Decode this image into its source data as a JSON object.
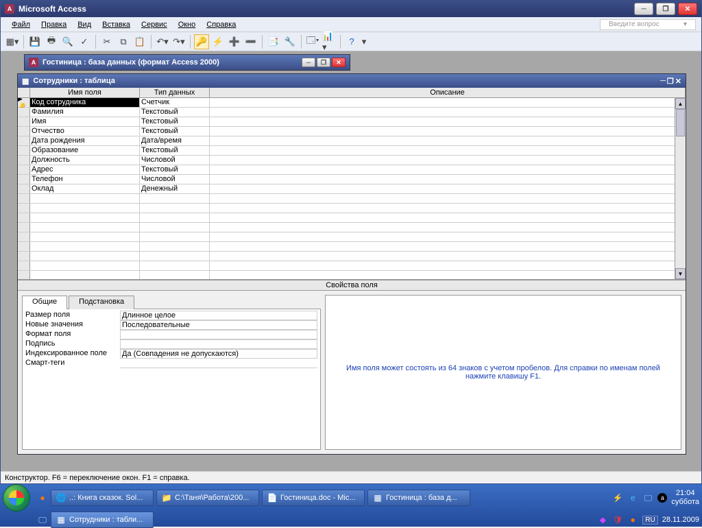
{
  "app": {
    "title": "Microsoft Access",
    "help_placeholder": "Введите вопрос"
  },
  "menu": [
    "Файл",
    "Правка",
    "Вид",
    "Вставка",
    "Сервис",
    "Окно",
    "Справка"
  ],
  "db_window_title": "Гостиница : база данных (формат Access 2000)",
  "table_window_title": "Сотрудники : таблица",
  "grid": {
    "headers": {
      "name": "Имя поля",
      "type": "Тип данных",
      "desc": "Описание"
    },
    "rows": [
      {
        "pk": true,
        "name": "Код сотрудника",
        "type": "Счетчик",
        "desc": ""
      },
      {
        "pk": false,
        "name": "Фамилия",
        "type": "Текстовый",
        "desc": ""
      },
      {
        "pk": false,
        "name": "Имя",
        "type": "Текстовый",
        "desc": ""
      },
      {
        "pk": false,
        "name": "Отчество",
        "type": "Текстовый",
        "desc": ""
      },
      {
        "pk": false,
        "name": "Дата рождения",
        "type": "Дата/время",
        "desc": ""
      },
      {
        "pk": false,
        "name": "Образование",
        "type": "Текстовый",
        "desc": ""
      },
      {
        "pk": false,
        "name": "Должность",
        "type": "Числовой",
        "desc": ""
      },
      {
        "pk": false,
        "name": "Адрес",
        "type": "Текстовый",
        "desc": ""
      },
      {
        "pk": false,
        "name": "Телефон",
        "type": "Числовой",
        "desc": ""
      },
      {
        "pk": false,
        "name": "Оклад",
        "type": "Денежный",
        "desc": ""
      }
    ]
  },
  "props": {
    "caption": "Свойства поля",
    "tabs": {
      "general": "Общие",
      "lookup": "Подстановка"
    },
    "rows": [
      {
        "label": "Размер поля",
        "value": "Длинное целое"
      },
      {
        "label": "Новые значения",
        "value": "Последовательные"
      },
      {
        "label": "Формат поля",
        "value": ""
      },
      {
        "label": "Подпись",
        "value": ""
      },
      {
        "label": "Индексированное поле",
        "value": "Да (Совпадения не допускаются)"
      },
      {
        "label": "Смарт-теги",
        "value": ""
      }
    ],
    "help_text": "Имя поля может состоять из 64 знаков с учетом пробелов.  Для справки по именам полей нажмите клавишу F1."
  },
  "status_bar": "Конструктор.  F6 = переключение окон.  F1 = справка.",
  "taskbar": {
    "buttons_row1": [
      "..: Книга сказок. Sol...",
      "С:\\Таня\\Работа\\200...",
      "Гостиница.doc - Mic...",
      "Гостиница : база д..."
    ],
    "buttons_row2": [
      "Сотрудники : табли..."
    ],
    "lang": "RU",
    "time": "21:04",
    "date": "28.11.2009",
    "day": "суббота"
  }
}
